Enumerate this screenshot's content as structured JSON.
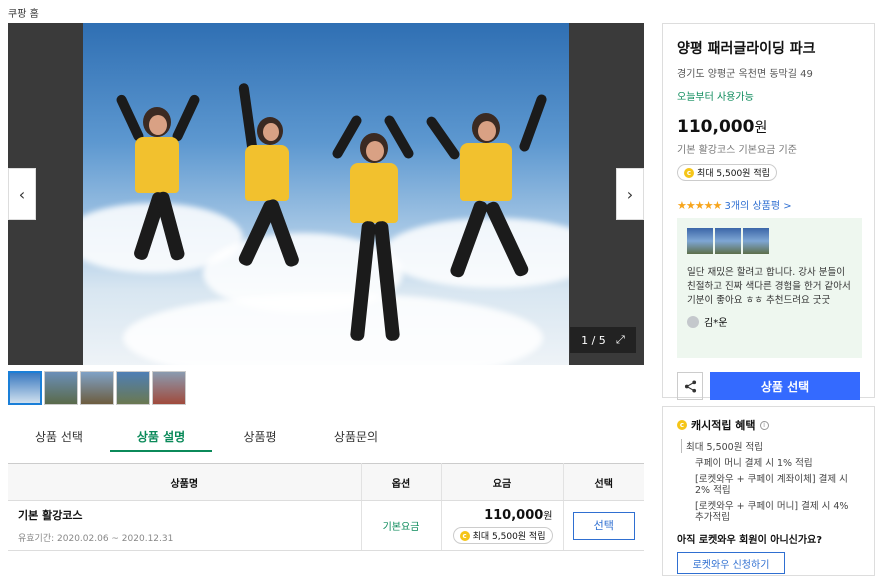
{
  "breadcrumb": "쿠팡 홈",
  "gallery": {
    "counter": "1 / 5",
    "prev_icon": "chevron-left-icon",
    "next_icon": "chevron-right-icon",
    "expand_icon": "expand-icon"
  },
  "tabs": [
    {
      "label": "상품 선택"
    },
    {
      "label": "상품 설명"
    },
    {
      "label": "상품평"
    },
    {
      "label": "상품문의"
    }
  ],
  "table": {
    "headers": [
      "상품명",
      "옵션",
      "요금",
      "선택"
    ],
    "rows": [
      {
        "name": "기본 활강코스",
        "period": "유효기간: 2020.02.06 ~ 2020.12.31",
        "option": "기본요금",
        "price": "110,000",
        "price_unit": "원",
        "reward": "최대 5,500원 적립",
        "select": "선택"
      }
    ]
  },
  "card": {
    "title": "양평 패러글라이딩 파크",
    "address": "경기도 양평군 옥천면 동막길 49",
    "availability": "오늘부터 사용가능",
    "price": "110,000",
    "price_unit": "원",
    "price_sub": "기본 활강코스 기본요금 기준",
    "reward": "최대 5,500원 적립",
    "stars": "★★★★★",
    "review_count": "3개의 상품평 >",
    "review_text": "일단 재밌은 할려고 합니다. 강사 분들이 친절하고 진짜 색다른 경험을 한거 같아서 기분이 좋아요 ㅎㅎ 추천드려요 굿굿",
    "reviewer": "김*운",
    "cta": "상품 선택"
  },
  "cash": {
    "title": "캐시적립 혜택",
    "max": "최대 5,500원 적립",
    "lines": [
      "쿠페이 머니 결제 시 1% 적립",
      "[로켓와우 + 쿠페이 계좌이체] 결제 시 2% 적립",
      "[로켓와우 + 쿠페이 머니] 결제 시 4% 추가적립"
    ],
    "question": "아직 로켓와우 회원이 아니신가요?",
    "button": "로켓와우 신청하기"
  },
  "colors": {
    "accent": "#0b8a5a",
    "primary": "#346aff",
    "coin": "#f5c518",
    "star": "#f7a51c"
  }
}
